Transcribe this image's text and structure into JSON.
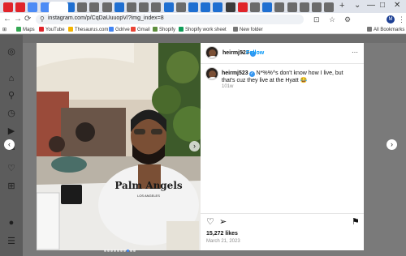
{
  "browser": {
    "url": "instagram.com/p/CqDaUuuopV/?img_index=8",
    "new_tab_glyph": "+",
    "window_controls": [
      "⌄",
      "—",
      "□",
      "✕"
    ],
    "nav_glyphs": [
      "←",
      "→",
      "⟳"
    ],
    "lock_glyph": "⚲",
    "toolbar_glyphs": [
      "⊡",
      "☆",
      "⚙",
      "⋮"
    ],
    "profile_initial": "M",
    "tabs": [
      {
        "color": "#e0242a"
      },
      {
        "color": "#e0242a"
      },
      {
        "color": "#4c8bf5"
      },
      {
        "color": "#4c8bf5"
      },
      {
        "color": "#ffffff"
      },
      {
        "color": "#1f6fd1"
      },
      {
        "color": "#6b6b6b"
      },
      {
        "color": "#6b6b6b"
      },
      {
        "color": "#6b6b6b"
      },
      {
        "color": "#1f6fd1"
      },
      {
        "color": "#6b6b6b"
      },
      {
        "color": "#6b6b6b"
      },
      {
        "color": "#6b6b6b"
      },
      {
        "color": "#1f6fd1"
      },
      {
        "color": "#6b6b6b"
      },
      {
        "color": "#1f6fd1"
      },
      {
        "color": "#1f6fd1"
      },
      {
        "color": "#1f6fd1"
      },
      {
        "color": "#3a3a3a"
      },
      {
        "color": "#e0242a"
      },
      {
        "color": "#6b6b6b"
      },
      {
        "color": "#1f6fd1"
      },
      {
        "color": "#6b6b6b"
      },
      {
        "color": "#6b6b6b"
      },
      {
        "color": "#6b6b6b"
      },
      {
        "color": "#6b6b6b"
      },
      {
        "color": "#6b6b6b"
      }
    ],
    "bookmarks": [
      {
        "label": "Maps",
        "color": "#34a853"
      },
      {
        "label": "YouTube",
        "color": "#e0242a"
      },
      {
        "label": "Thesaurus.com",
        "color": "#f4b400"
      },
      {
        "label": "Gdrive",
        "color": "#4285f4"
      },
      {
        "label": "Gmail",
        "color": "#ea4335"
      },
      {
        "label": "Shopify",
        "color": "#5e8e3e"
      },
      {
        "label": "Shopify work sheet",
        "color": "#0f9d58"
      },
      {
        "label": "New folder",
        "color": "#777777"
      },
      {
        "label": "All Bookmarks",
        "color": "#777777"
      }
    ]
  },
  "sidenav": {
    "icons": [
      "instagram-icon",
      "home-icon",
      "search-icon",
      "explore-icon",
      "reels-icon",
      "messages-icon",
      "notifications-icon",
      "create-icon",
      "profile-icon",
      "threads-icon",
      "menu-icon"
    ],
    "glyphs": [
      "◎",
      "⌂",
      "⚲",
      "◷",
      "▶",
      "✉",
      "♡",
      "⊞",
      "●",
      "@",
      "☰"
    ]
  },
  "modal": {
    "close_glyph": "✕",
    "prev_glyph": "‹",
    "next_glyph": "›",
    "carousel_count": 10,
    "carousel_active_index": 7
  },
  "post": {
    "username": "heirmj523",
    "verified_glyph": "✓",
    "separator": "•",
    "follow_label": "Follow",
    "more_glyph": "···",
    "caption_username": "heirmj523",
    "caption_text": "N*%%^s don't know how I live, but that's cuz they live at the Hyatt 😂",
    "caption_age": "101w",
    "likes": "15,272 likes",
    "date": "March 21, 2023",
    "action_glyphs": {
      "like": "♡",
      "share": "➢",
      "save": "⚑"
    },
    "shirt_text_line1": "Palm Angels",
    "shirt_text_line2": "LOS ANGELES"
  }
}
